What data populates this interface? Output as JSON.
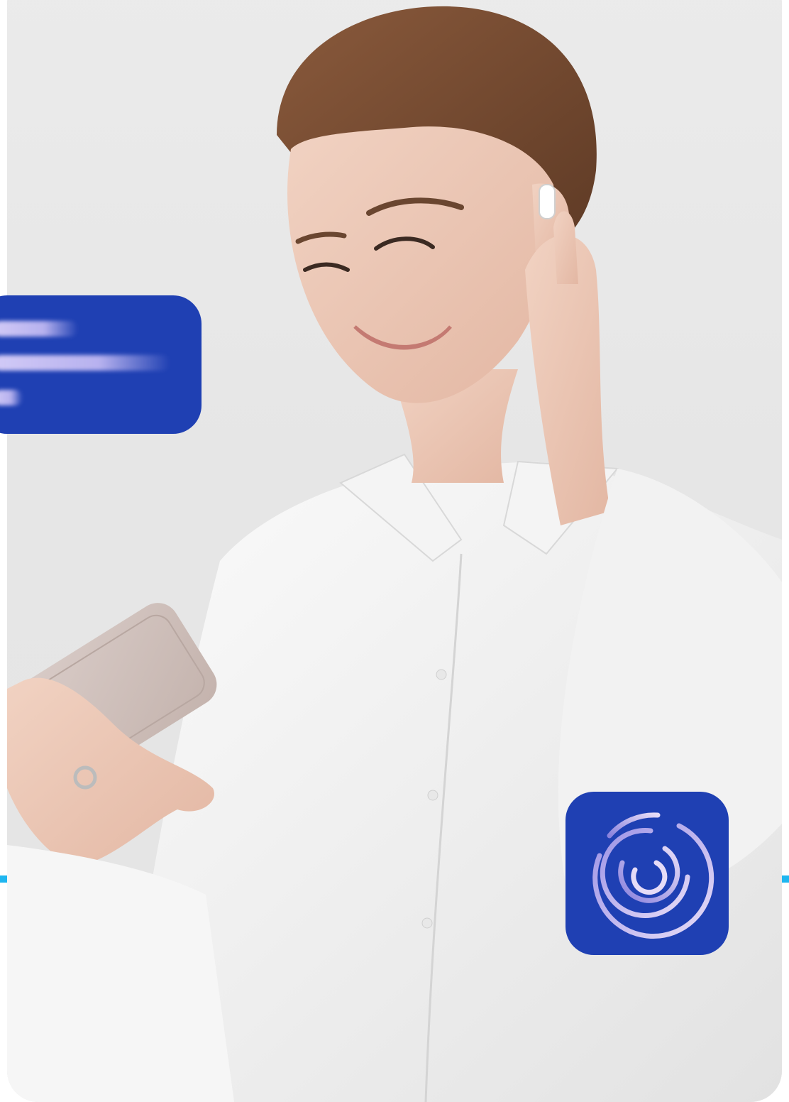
{
  "photo": {
    "subject": "smiling-woman-with-phone-and-earbud-icon"
  },
  "colors": {
    "background": "#e8e8e8",
    "brand_blue": "#1f40b3",
    "accent_cyan": "#1fb6f0",
    "ring_light": "#e6dcf7",
    "ring_mid": "#9c93e6"
  },
  "message_card": {
    "icon": "blurred-text-lines-icon"
  },
  "app_tile": {
    "icon": "concentric-rings-logo-icon"
  }
}
